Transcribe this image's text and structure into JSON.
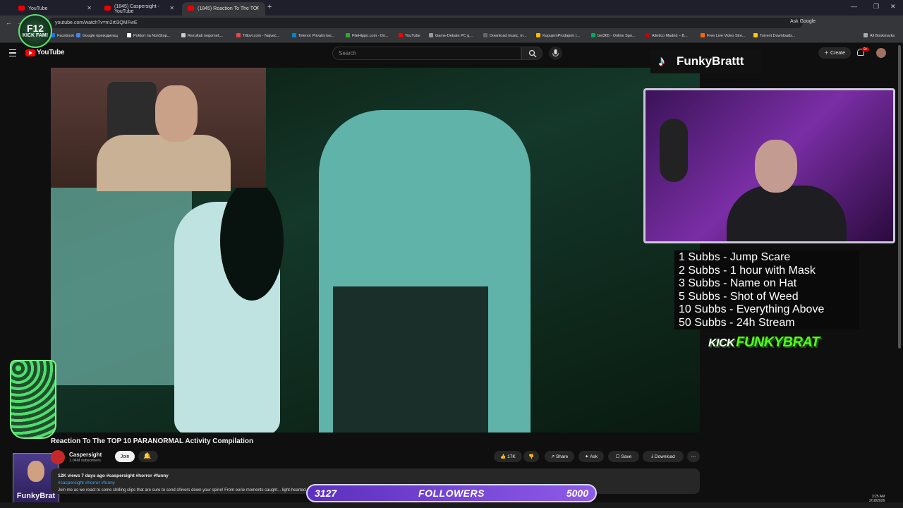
{
  "browser": {
    "tabs": [
      {
        "label": "YouTube"
      },
      {
        "label": "(1845) Caspersight - YouTube"
      },
      {
        "label": "(1845) Reaction To The TO!"
      }
    ],
    "url": "youtube.com/watch?v=m2rtl3QMFwE",
    "ask_google": "Ask Google",
    "bookmarks": [
      "Facebook",
      "Google преводилац",
      "Poktori na NonStop...",
      "Rezultati nogomet,...",
      "Titlovi.com - Najveć...",
      "Telenor Privatni kor...",
      "FileHippo.com - Do...",
      "YouTube",
      "Game-Debate PC g...",
      "Download music, m...",
      "KupujemProdajem |...",
      "bet365 - Online Spo...",
      "Atletico Madrid – B...",
      "Free Live Video Stre...",
      "Torrent Downloads..."
    ],
    "all_bookmarks": "All Bookmarks"
  },
  "badge": {
    "line1": "F12",
    "line2": "KICK FAM!"
  },
  "youtube": {
    "logo": "YouTube",
    "search_placeholder": "Search",
    "create_label": "Create",
    "notif_count": "9+"
  },
  "video": {
    "title": "Reaction To The TOP 10 PARANORMAL Activity Compilation",
    "channel": "Caspersight",
    "subscribers": "1.04M subscribers",
    "join_label": "Join",
    "likes": "17K",
    "share_label": "Share",
    "ask_label": "Ask",
    "save_label": "Save",
    "download_label": "Download",
    "views_line": "12K views  7 days ago  #caspersight #horror #funny",
    "tags_line": "#caspersight #horror #funny",
    "description": "Join me as we react to some chilling clips that are sure to send shivers down your spine! From eerie moments caught... light-hearted. Remember, don't watch alone! Let me know what you think below! 👻"
  },
  "overlay": {
    "tiktok_name": "FunkyBrattt",
    "subs_list": [
      "1 Subbs - Jump Scare",
      "2 Subbs - 1 hour with Mask",
      "3 Subbs - Name on Hat",
      "5 Subbs - Shot of Weed",
      "10 Subbs - Everything Above",
      "50 Subbs - 24h Stream"
    ],
    "kick_prefix": "KICK",
    "kick_name": "FUNKYBRAT",
    "avatar_name": "FunkyBrat",
    "followers_current": "3127",
    "followers_label": "FOLLOWERS",
    "followers_goal": "5000"
  },
  "system": {
    "time": "3:25 AM",
    "date": "2/18/2026"
  }
}
